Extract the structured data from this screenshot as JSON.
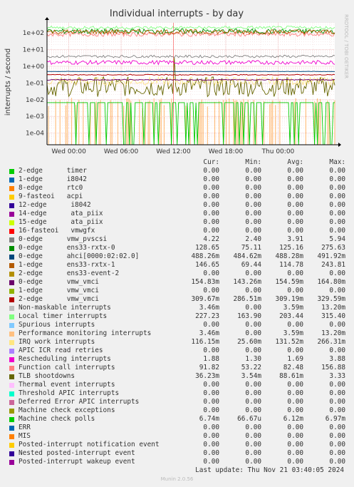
{
  "chart_data": {
    "type": "line",
    "title": "Individual interrupts - by day",
    "ylabel": "interrupts / second",
    "side_label": "RRDTOOL / TOBI OETIKER",
    "yscale": "log",
    "ylim": [
      2e-05,
      400
    ],
    "y_ticks": [
      {
        "value": 100,
        "label": "1e+02"
      },
      {
        "value": 10,
        "label": "1e+01"
      },
      {
        "value": 1,
        "label": "1e+00"
      },
      {
        "value": 0.1,
        "label": "1e-01"
      },
      {
        "value": 0.01,
        "label": "1e-02"
      },
      {
        "value": 0.001,
        "label": "1e-03"
      },
      {
        "value": 0.0001,
        "label": "1e-04"
      }
    ],
    "x_range_hours": [
      -2.5,
      30.5
    ],
    "x_ticks": [
      {
        "hour": 0,
        "label": "Wed 00:00"
      },
      {
        "hour": 6,
        "label": "Wed 06:00"
      },
      {
        "hour": 12,
        "label": "Wed 12:00"
      },
      {
        "hour": 18,
        "label": "Wed 18:00"
      },
      {
        "hour": 24,
        "label": "Thu 00:00"
      }
    ],
    "now_hour": 12,
    "grid": true,
    "columns": [
      "Cur:",
      "Min:",
      "Avg:",
      "Max:"
    ],
    "series": [
      {
        "name": "2-edge      timer",
        "color": "#00cc00",
        "cur": "0.00",
        "min": "0.00",
        "avg": "0.00",
        "max": "0.00"
      },
      {
        "name": "1-edge      i8042",
        "color": "#0066b3",
        "cur": "0.00",
        "min": "0.00",
        "avg": "0.00",
        "max": "0.00"
      },
      {
        "name": "8-edge      rtc0",
        "color": "#ff8000",
        "cur": "0.00",
        "min": "0.00",
        "avg": "0.00",
        "max": "0.00"
      },
      {
        "name": "9-fasteoi   acpi",
        "color": "#ffcc00",
        "cur": "0.00",
        "min": "0.00",
        "avg": "0.00",
        "max": "0.00"
      },
      {
        "name": "12-edge      i8042",
        "color": "#330099",
        "cur": "0.00",
        "min": "0.00",
        "avg": "0.00",
        "max": "0.00"
      },
      {
        "name": "14-edge      ata_piix",
        "color": "#990099",
        "cur": "0.00",
        "min": "0.00",
        "avg": "0.00",
        "max": "0.00"
      },
      {
        "name": "15-edge      ata_piix",
        "color": "#ccff00",
        "cur": "0.00",
        "min": "0.00",
        "avg": "0.00",
        "max": "0.00"
      },
      {
        "name": "16-fasteoi   vmwgfx",
        "color": "#ff0000",
        "cur": "0.00",
        "min": "0.00",
        "avg": "0.00",
        "max": "0.00"
      },
      {
        "name": "0-edge      vmw_pvscsi",
        "color": "#808080",
        "cur": "4.22",
        "min": "2.40",
        "avg": "3.91",
        "max": "5.94"
      },
      {
        "name": "0-edge      ens33-rxtx-0",
        "color": "#008f00",
        "cur": "128.65",
        "min": "75.11",
        "avg": "125.16",
        "max": "275.63"
      },
      {
        "name": "0-edge      ahci[0000:02:02.0]",
        "color": "#00487d",
        "cur": "488.26m",
        "min": "484.62m",
        "avg": "488.28m",
        "max": "491.92m"
      },
      {
        "name": "1-edge      ens33-rxtx-1",
        "color": "#b35a00",
        "cur": "146.65",
        "min": "69.44",
        "avg": "114.78",
        "max": "243.81"
      },
      {
        "name": "2-edge      ens33-event-2",
        "color": "#b38f00",
        "cur": "0.00",
        "min": "0.00",
        "avg": "0.00",
        "max": "0.00"
      },
      {
        "name": "0-edge      vmw_vmci",
        "color": "#6b006b",
        "cur": "154.83m",
        "min": "143.26m",
        "avg": "154.59m",
        "max": "164.80m"
      },
      {
        "name": "1-edge      vmw_vmci",
        "color": "#8fb300",
        "cur": "0.00",
        "min": "0.00",
        "avg": "0.00",
        "max": "0.00"
      },
      {
        "name": "2-edge      vmw_vmci",
        "color": "#b30000",
        "cur": "309.67m",
        "min": "286.51m",
        "avg": "309.19m",
        "max": "329.59m"
      },
      {
        "name": "Non-maskable interrupts",
        "color": "#bebebe",
        "cur": "3.46m",
        "min": "0.00",
        "avg": "3.59m",
        "max": "13.20m"
      },
      {
        "name": "Local timer interrupts",
        "color": "#80ff80",
        "cur": "227.23",
        "min": "163.90",
        "avg": "203.44",
        "max": "315.40"
      },
      {
        "name": "Spurious interrupts",
        "color": "#80c9ff",
        "cur": "0.00",
        "min": "0.00",
        "avg": "0.00",
        "max": "0.00"
      },
      {
        "name": "Performance monitoring interrupts",
        "color": "#ffc080",
        "cur": "3.46m",
        "min": "0.00",
        "avg": "3.59m",
        "max": "13.20m"
      },
      {
        "name": "IRQ work interrupts",
        "color": "#ffe680",
        "cur": "116.15m",
        "min": "25.60m",
        "avg": "131.52m",
        "max": "266.31m"
      },
      {
        "name": "APIC ICR read retries",
        "color": "#aa80ff",
        "cur": "0.00",
        "min": "0.00",
        "avg": "0.00",
        "max": "0.00"
      },
      {
        "name": "Rescheduling interrupts",
        "color": "#ee00cc",
        "cur": "1.88",
        "min": "1.30",
        "avg": "1.69",
        "max": "3.88"
      },
      {
        "name": "Function call interrupts",
        "color": "#ff8080",
        "cur": "91.82",
        "min": "53.22",
        "avg": "82.48",
        "max": "156.88"
      },
      {
        "name": "TLB shootdowns",
        "color": "#666600",
        "cur": "36.23m",
        "min": "3.54m",
        "avg": "88.61m",
        "max": "3.33"
      },
      {
        "name": "Thermal event interrupts",
        "color": "#ffbfff",
        "cur": "0.00",
        "min": "0.00",
        "avg": "0.00",
        "max": "0.00"
      },
      {
        "name": "Threshold APIC interrupts",
        "color": "#00ffcc",
        "cur": "0.00",
        "min": "0.00",
        "avg": "0.00",
        "max": "0.00"
      },
      {
        "name": "Deferred Error APIC interrupts",
        "color": "#cc6699",
        "cur": "0.00",
        "min": "0.00",
        "avg": "0.00",
        "max": "0.00"
      },
      {
        "name": "Machine check exceptions",
        "color": "#999900",
        "cur": "0.00",
        "min": "0.00",
        "avg": "0.00",
        "max": "0.00"
      },
      {
        "name": "Machine check polls",
        "color": "#00cc00",
        "cur": "6.74m",
        "min": "66.67u",
        "avg": "6.12m",
        "max": "6.97m"
      },
      {
        "name": "ERR",
        "color": "#0066b3",
        "cur": "0.00",
        "min": "0.00",
        "avg": "0.00",
        "max": "0.00"
      },
      {
        "name": "MIS",
        "color": "#ff8000",
        "cur": "0.00",
        "min": "0.00",
        "avg": "0.00",
        "max": "0.00"
      },
      {
        "name": "Posted-interrupt notification event",
        "color": "#ffcc00",
        "cur": "0.00",
        "min": "0.00",
        "avg": "0.00",
        "max": "0.00"
      },
      {
        "name": "Nested posted-interrupt event",
        "color": "#330099",
        "cur": "0.00",
        "min": "0.00",
        "avg": "0.00",
        "max": "0.00"
      },
      {
        "name": "Posted-interrupt wakeup event",
        "color": "#990099",
        "cur": "0.00",
        "min": "0.00",
        "avg": "0.00",
        "max": "0.00"
      }
    ]
  },
  "footer": {
    "last_update": "Last update: Thu Nov 21 03:40:05 2024",
    "version": "Munin 2.0.56"
  }
}
